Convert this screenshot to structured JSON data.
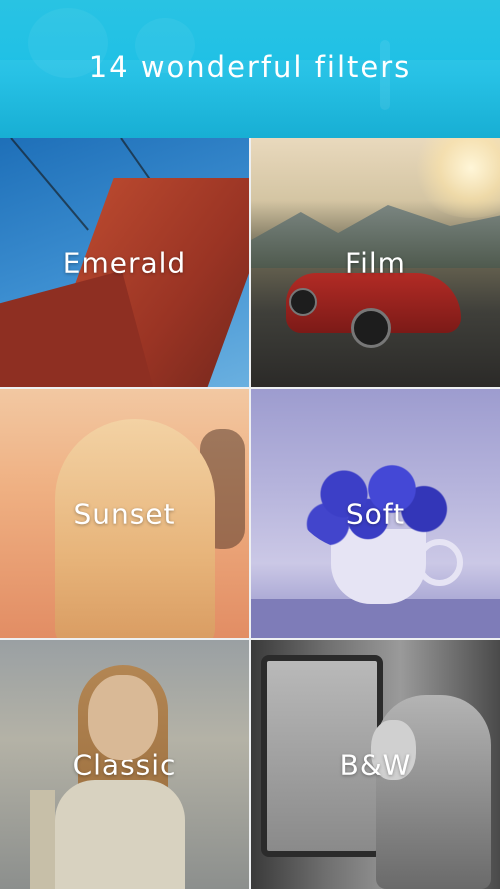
{
  "header": {
    "title": "14 wonderful filters"
  },
  "filters": [
    {
      "label": "Emerald"
    },
    {
      "label": "Film"
    },
    {
      "label": "Sunset"
    },
    {
      "label": "Soft"
    },
    {
      "label": "Classic"
    },
    {
      "label": "B&W"
    }
  ],
  "colors": {
    "header_background": "#1ec0e6",
    "label_text": "#ffffff"
  }
}
